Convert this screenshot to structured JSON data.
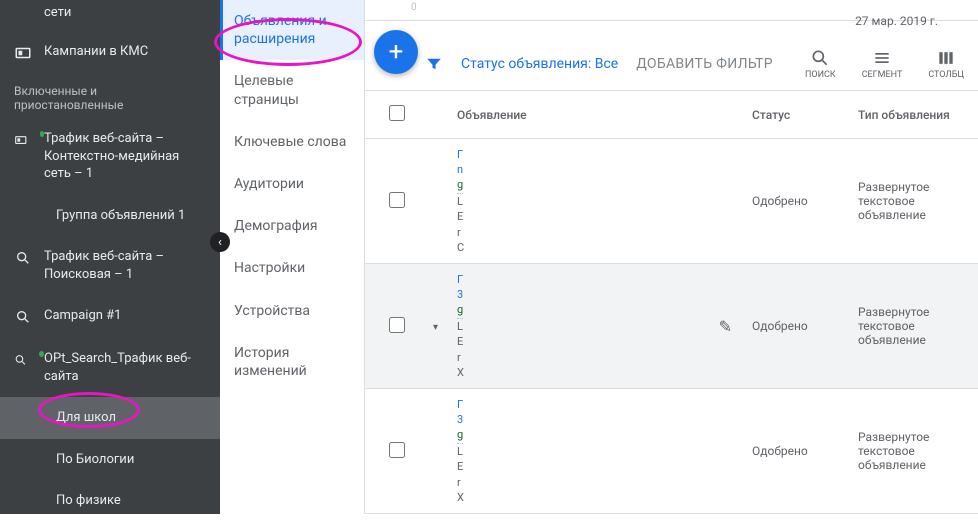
{
  "sidebar_left": {
    "top_truncated": "сети",
    "kmc": "Кампании в КМС",
    "heading": "Включенные и приостановленные",
    "items": [
      {
        "label": "Трафик веб-сайта – Контекстно-медийная сеть – 1",
        "dot": true
      },
      {
        "label": "Группа объявлений 1",
        "sub": true
      },
      {
        "label": "Трафик веб-сайта – Поисковая – 1",
        "icon": "search"
      },
      {
        "label": "Campaign #1",
        "icon": "search"
      },
      {
        "label": "OPt_Search_Трафик веб-сайта",
        "icon": "search",
        "dot": true
      },
      {
        "label": "Для школ",
        "sub": true,
        "selected": true
      },
      {
        "label": "По Биологии",
        "sub": true
      },
      {
        "label": "По физике",
        "sub": true
      }
    ]
  },
  "sidebar_mid": {
    "items": [
      {
        "label": "Объявления и расширения",
        "active": true
      },
      {
        "label": "Целевые страницы"
      },
      {
        "label": "Ключевые слова"
      },
      {
        "label": "Аудитории"
      },
      {
        "label": "Демография"
      },
      {
        "label": "Настройки"
      },
      {
        "label": "Устройства"
      },
      {
        "label": "История изменений"
      }
    ]
  },
  "timeline": {
    "date": "27 мар. 2019 г."
  },
  "toolbar": {
    "status_label": "Статус объявления:",
    "status_value": "Все",
    "add_filter": "ДОБАВИТЬ ФИЛЬТР",
    "search": "ПОИСК",
    "segment": "СЕГМЕНТ",
    "columns": "СТОЛБЦ"
  },
  "table": {
    "head": {
      "ad": "Объявление",
      "status": "Статус",
      "type": "Тип объявления"
    },
    "rows": [
      {
        "lines": [
          "Г",
          "n",
          "g",
          "L",
          "E",
          "r",
          "C"
        ],
        "status": "Одобрено",
        "type": "Развернутое текстовое объявление"
      },
      {
        "lines": [
          "Г",
          "3",
          "g",
          "L",
          "E",
          "r",
          "X"
        ],
        "status": "Одобрено",
        "type": "Развернутое текстовое объявление",
        "hover": true
      },
      {
        "lines": [
          "Г",
          "3",
          "g",
          "L",
          "E",
          "r",
          "X"
        ],
        "status": "Одобрено",
        "type": "Развернутое текстовое объявление"
      }
    ]
  }
}
